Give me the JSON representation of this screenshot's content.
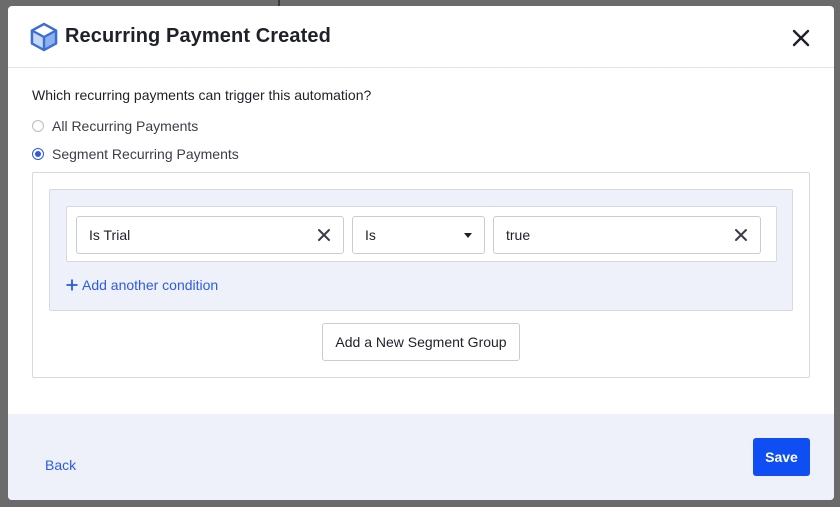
{
  "modal": {
    "title": "Recurring Payment Created",
    "icon": "cube-icon",
    "accent": "#2d5be3"
  },
  "trigger": {
    "question": "Which recurring payments can trigger this automation?",
    "options": [
      {
        "label": "All Recurring Payments",
        "selected": false
      },
      {
        "label": "Segment Recurring Payments",
        "selected": true
      }
    ]
  },
  "segment": {
    "condition": {
      "field": "Is Trial",
      "operator": "Is",
      "value": "true"
    },
    "add_condition_label": "Add another condition",
    "add_group_label": "Add a New Segment Group"
  },
  "footer": {
    "back_label": "Back",
    "save_label": "Save",
    "save_color": "#0f4ef2"
  }
}
